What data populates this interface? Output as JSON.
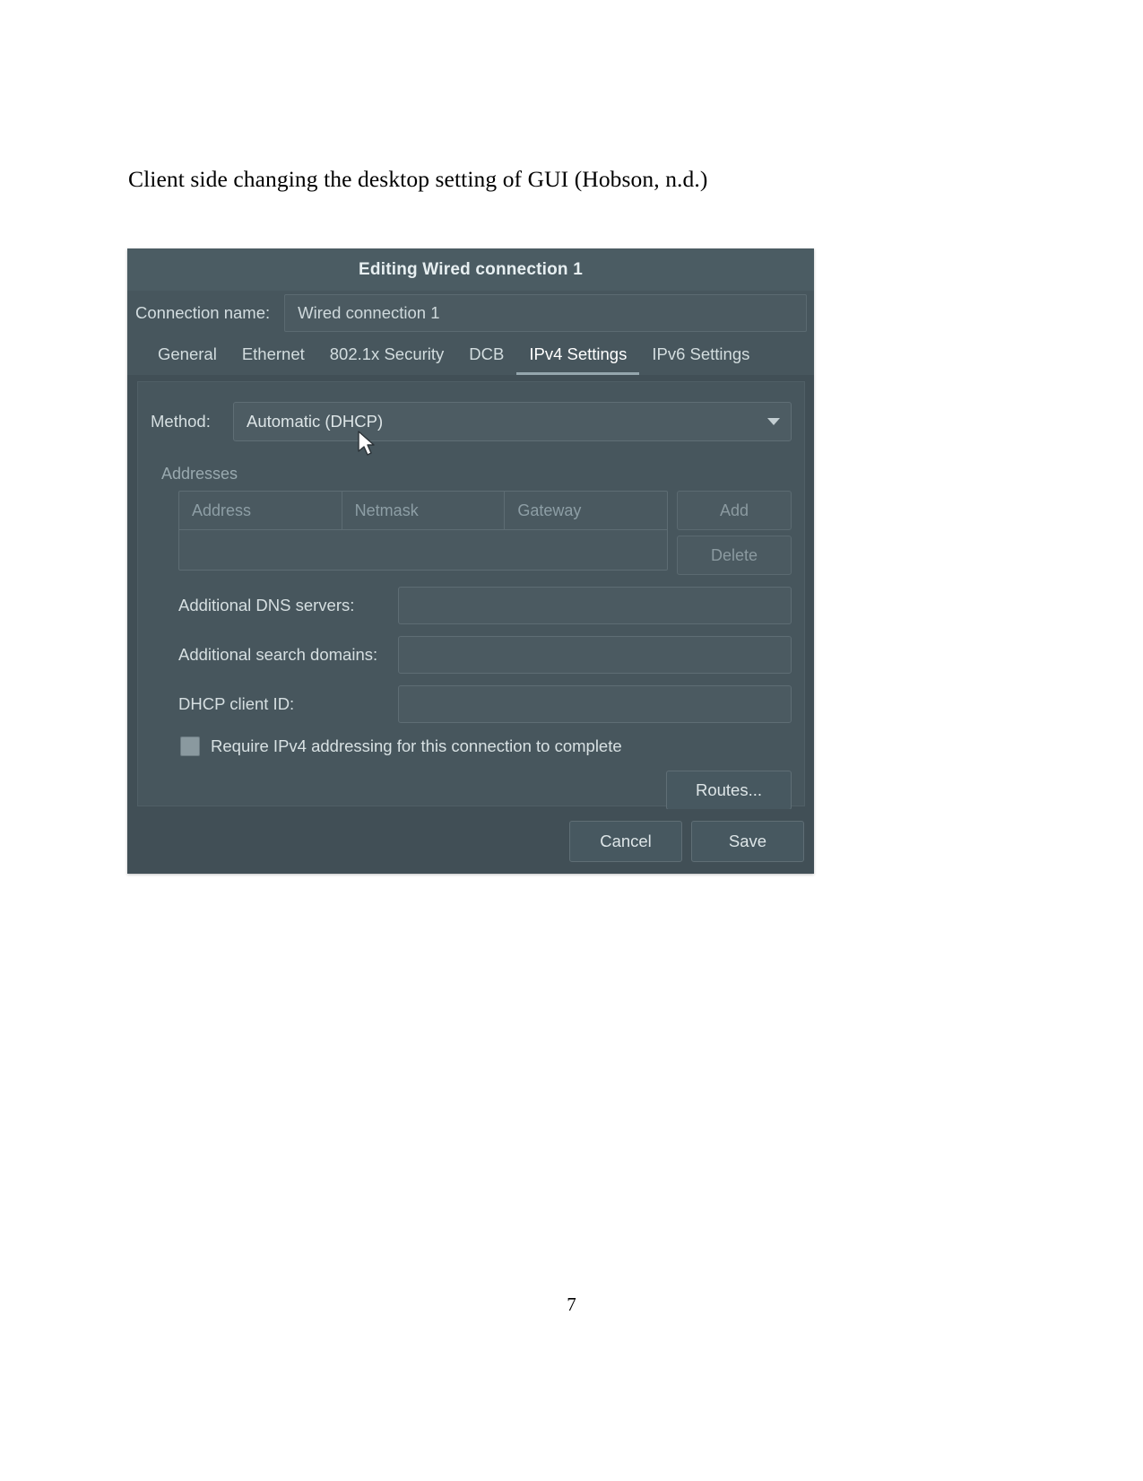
{
  "document": {
    "caption": "Client side changing the desktop setting of GUI (Hobson, n.d.)",
    "page_number": "7"
  },
  "dialog": {
    "title": "Editing Wired connection 1",
    "connection_name": {
      "label": "Connection name:",
      "value": "Wired connection 1"
    },
    "tabs": [
      {
        "label": "General",
        "active": false
      },
      {
        "label": "Ethernet",
        "active": false
      },
      {
        "label": "802.1x Security",
        "active": false
      },
      {
        "label": "DCB",
        "active": false
      },
      {
        "label": "IPv4 Settings",
        "active": true
      },
      {
        "label": "IPv6 Settings",
        "active": false
      }
    ],
    "ipv4": {
      "method_label": "Method:",
      "method_value": "Automatic (DHCP)",
      "addresses_group_label": "Addresses",
      "addresses_columns": [
        "Address",
        "Netmask",
        "Gateway"
      ],
      "addresses_rows": [],
      "add_button": "Add",
      "delete_button": "Delete",
      "dns_label": "Additional DNS servers:",
      "dns_value": "",
      "search_domains_label": "Additional search domains:",
      "search_domains_value": "",
      "dhcp_client_id_label": "DHCP client ID:",
      "dhcp_client_id_value": "",
      "require_ipv4_label": "Require IPv4 addressing for this connection to complete",
      "require_ipv4_checked": false,
      "routes_button": "Routes..."
    },
    "footer": {
      "cancel_button": "Cancel",
      "save_button": "Save"
    }
  },
  "colors": {
    "window_bg": "#414f56",
    "titlebar_bg": "#4b5c63",
    "panel_bg": "#47565d",
    "input_bg": "#4b5a61",
    "border": "#5e6d74",
    "text": "#d6dfe1",
    "muted_text": "#8d9ea5",
    "active_tab_underline": "#94a6ad"
  }
}
